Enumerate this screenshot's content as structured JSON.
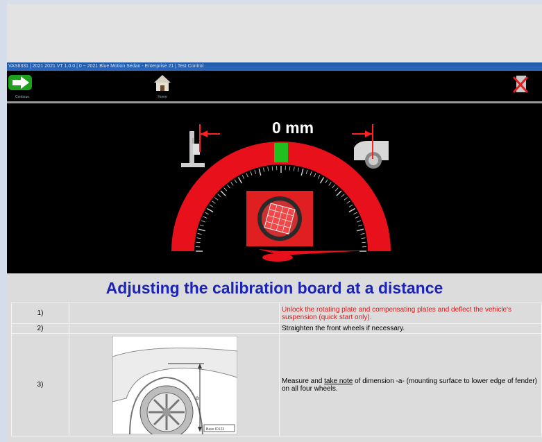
{
  "window": {
    "title": "VAS6331 | 2021 2021 VT 1.0.0 | 0 ~ 2021 Blue Motion Sedan - Enterprise 21 | Test Control"
  },
  "toolbar": {
    "next_label": "Continue",
    "home_label": "Home",
    "exit_label": "Exit"
  },
  "gauge": {
    "value_text": "0 mm",
    "indicator_fraction": 0.5
  },
  "colors": {
    "gauge_red": "#e8101a",
    "indicator_green": "#20c020",
    "heading_blue": "#1b23b8",
    "step_red": "#e01818"
  },
  "panel": {
    "heading": "Adjusting the calibration board at a distance",
    "steps": [
      {
        "number": "1)",
        "text": "Unlock the rotating plate and compensating plates and deflect the vehicle's suspension (quick start only)."
      },
      {
        "number": "2)",
        "text": "Straighten the front wheels if necessary."
      },
      {
        "number": "3)",
        "text_pre": "Measure and ",
        "text_underline": "take note",
        "text_post": " of dimension -a- (mounting surface to lower edge of fender) on all four wheels.",
        "image_label": "a",
        "image_caption": "Base ID123"
      }
    ]
  },
  "icons": [
    "next-arrow-icon",
    "home-icon",
    "exit-icon",
    "measuring-stand-icon",
    "car-wheel-icon",
    "calibration-target-icon"
  ]
}
